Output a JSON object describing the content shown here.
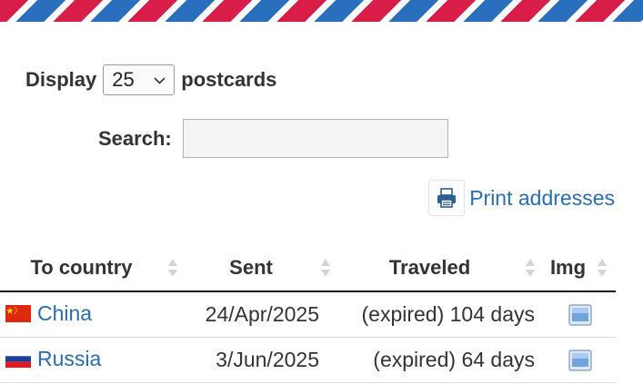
{
  "controls": {
    "display_label": "Display",
    "display_value": "25",
    "display_suffix": "postcards",
    "search_label": "Search:",
    "search_value": "",
    "print_label": "Print addresses"
  },
  "table": {
    "headers": [
      "To country",
      "Sent",
      "Traveled",
      "Img"
    ],
    "rows": [
      {
        "country": "China",
        "flag": "china-flag",
        "sent": "24/Apr/2025",
        "traveled": "(expired) 104 days",
        "img": "image-icon"
      },
      {
        "country": "Russia",
        "flag": "russia-flag",
        "sent": "3/Jun/2025",
        "traveled": "(expired) 64 days",
        "img": "image-icon"
      }
    ]
  },
  "colors": {
    "airmail_red": "#d81e48",
    "airmail_blue": "#2a6fbe",
    "link": "#2a6cb0"
  }
}
